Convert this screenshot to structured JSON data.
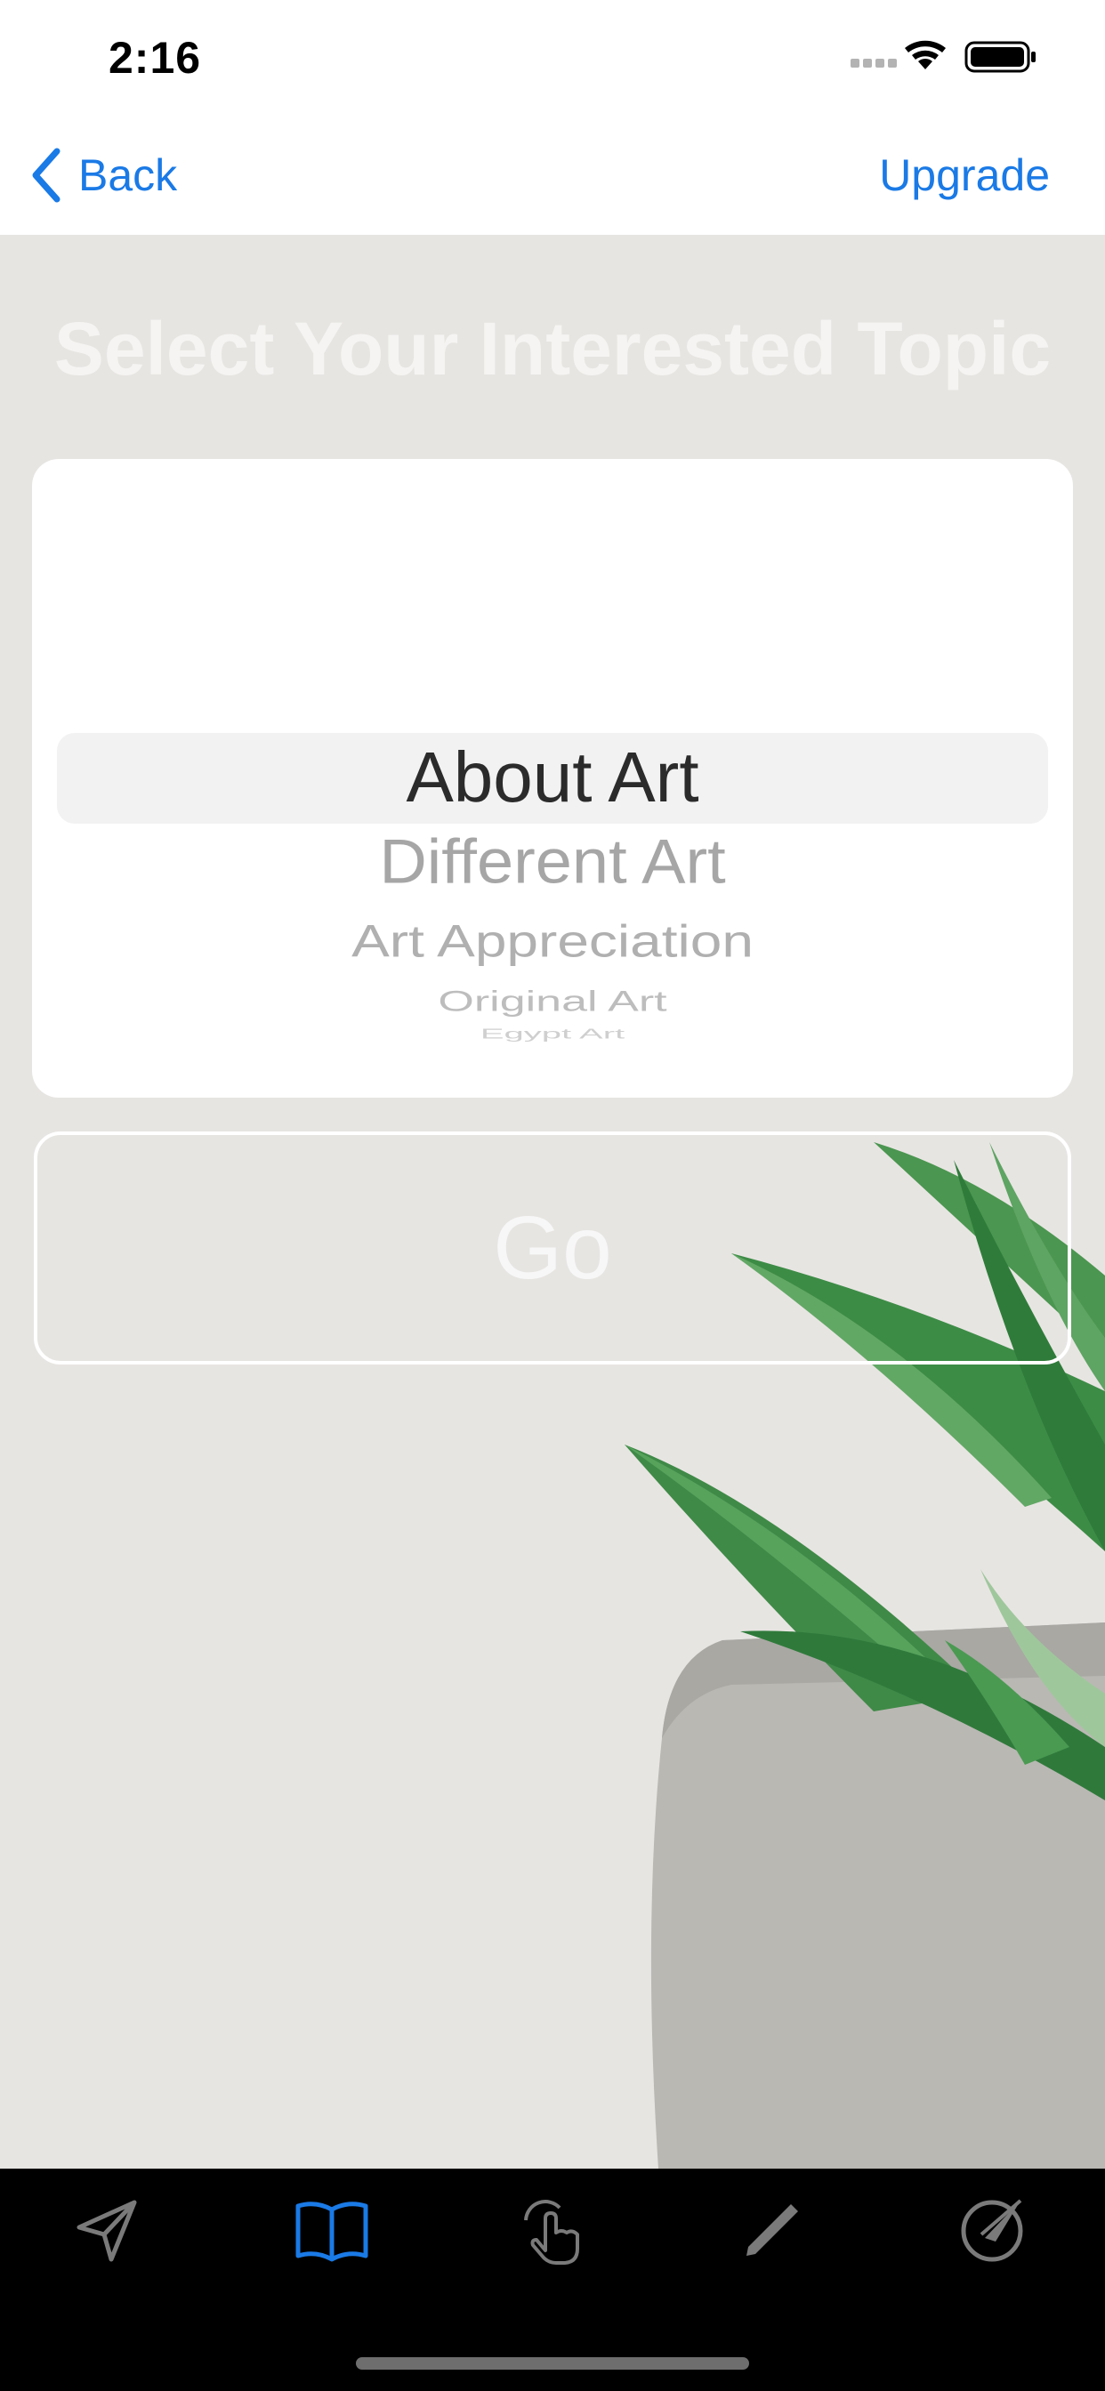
{
  "status_bar": {
    "time": "2:16"
  },
  "nav": {
    "back_label": "Back",
    "upgrade_label": "Upgrade"
  },
  "main": {
    "heading": "Select Your Interested Topic",
    "picker": {
      "selected": "About Art",
      "options": [
        "About Art",
        "Different Art",
        "Art Appreciation",
        "Original Art",
        "Egypt Art"
      ]
    },
    "go_label": "Go"
  },
  "tab_bar": {
    "tabs": [
      {
        "icon": "send-icon",
        "active": false
      },
      {
        "icon": "book-icon",
        "active": true
      },
      {
        "icon": "hand-tap-icon",
        "active": false
      },
      {
        "icon": "pencil-icon",
        "active": false
      },
      {
        "icon": "safari-icon",
        "active": false
      }
    ]
  },
  "colors": {
    "accent": "#1a7ae6",
    "background": "#e7e5e2",
    "tab_bar": "#000000",
    "inactive_tab": "#7a7a7a"
  }
}
